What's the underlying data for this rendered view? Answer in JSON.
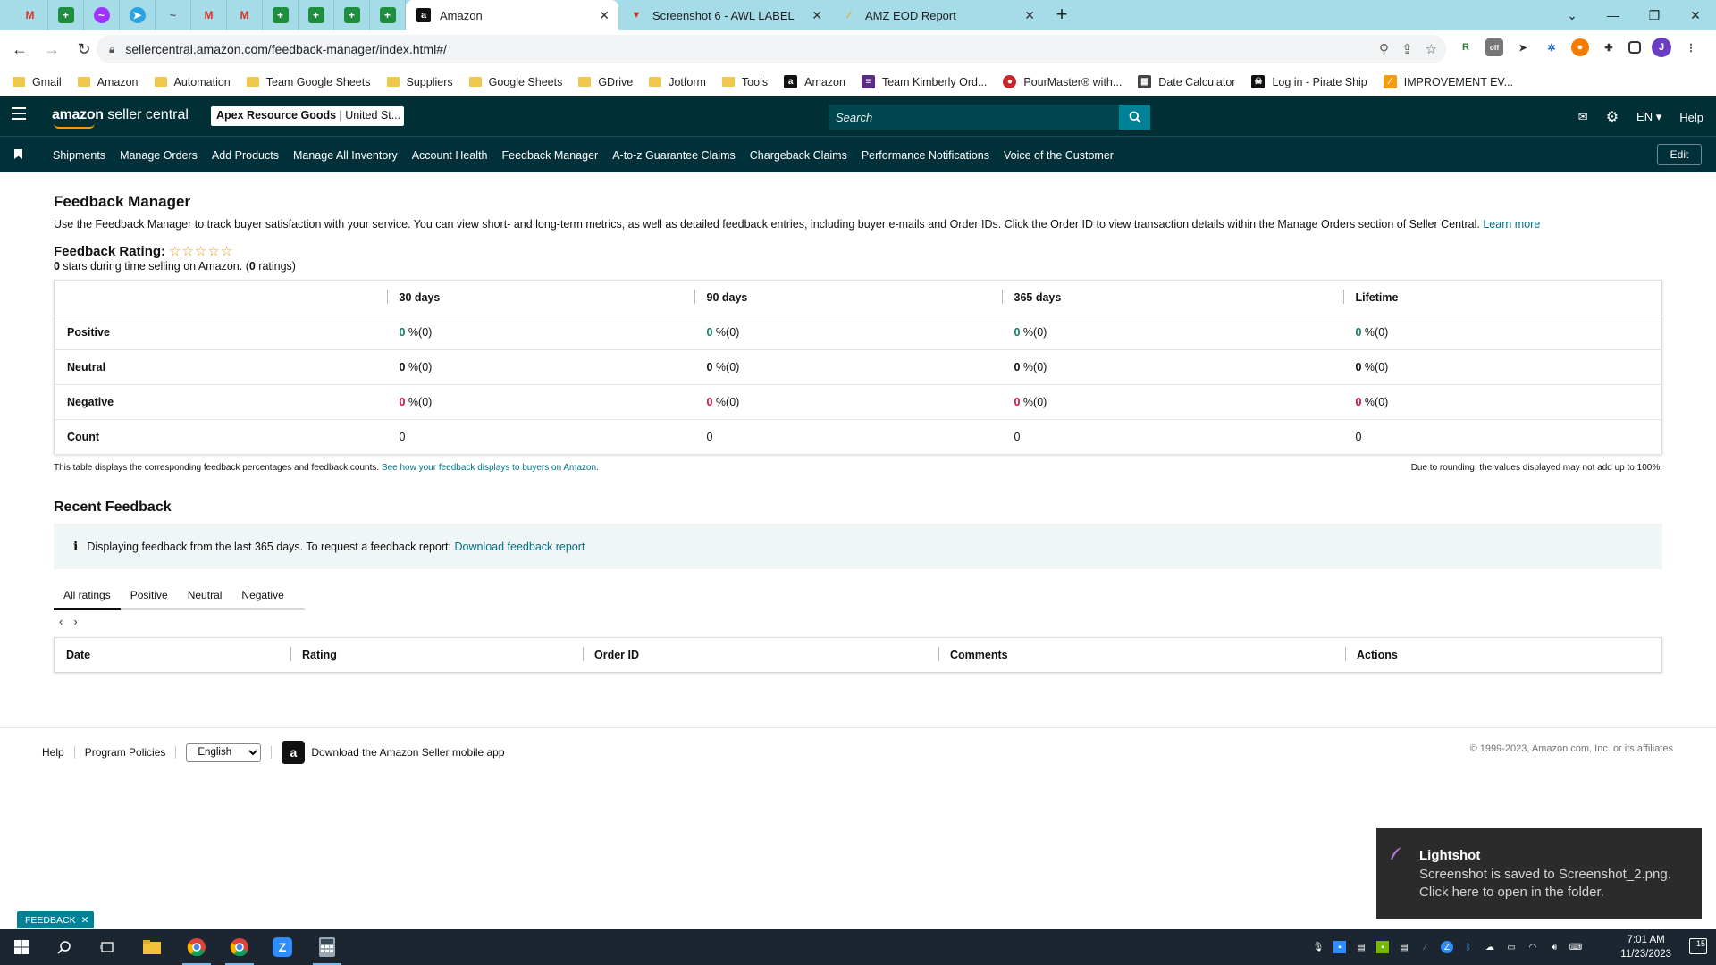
{
  "browser": {
    "tabs": [
      {
        "title": "Amazon",
        "active": true
      },
      {
        "title": "Screenshot 6 - AWL LABEL",
        "active": false
      },
      {
        "title": "AMZ EOD Report",
        "active": false
      }
    ],
    "new_tab": "+",
    "url": "sellercentral.amazon.com/feedback-manager/index.html#/",
    "bookmarks": [
      {
        "label": "Gmail",
        "type": "folder"
      },
      {
        "label": "Amazon",
        "type": "folder"
      },
      {
        "label": "Automation",
        "type": "folder"
      },
      {
        "label": "Team Google Sheets",
        "type": "folder"
      },
      {
        "label": "Suppliers",
        "type": "folder"
      },
      {
        "label": "Google Sheets",
        "type": "folder"
      },
      {
        "label": "GDrive",
        "type": "folder"
      },
      {
        "label": "Jotform",
        "type": "folder"
      },
      {
        "label": "Tools",
        "type": "folder"
      },
      {
        "label": "Amazon",
        "type": "site"
      },
      {
        "label": "Team Kimberly Ord...",
        "type": "site"
      },
      {
        "label": "PourMaster® with...",
        "type": "site"
      },
      {
        "label": "Date Calculator",
        "type": "site"
      },
      {
        "label": "Log in - Pirate Ship",
        "type": "site"
      },
      {
        "label": "IMPROVEMENT EV...",
        "type": "site"
      }
    ],
    "avatar_letter": "J"
  },
  "header": {
    "logo_bold": "amazon",
    "logo_rest": " seller central",
    "account_name": "Apex Resource Goods",
    "account_region": " | United St...",
    "search_placeholder": "Search",
    "language": "EN",
    "help": "Help"
  },
  "nav": {
    "items": [
      "Shipments",
      "Manage Orders",
      "Add Products",
      "Manage All Inventory",
      "Account Health",
      "Feedback Manager",
      "A-to-z Guarantee Claims",
      "Chargeback Claims",
      "Performance Notifications",
      "Voice of the Customer"
    ],
    "edit": "Edit"
  },
  "main": {
    "title": "Feedback Manager",
    "intro": "Use the Feedback Manager to track buyer satisfaction with your service. You can view short- and long-term metrics, as well as detailed feedback entries, including buyer e-mails and Order IDs. Click the Order ID to view transaction details within the Manage Orders section of Seller Central.",
    "learn_more": "Learn more",
    "rating_label": "Feedback Rating:",
    "stars_shown": "☆☆☆☆☆",
    "rating_count_bold": "0",
    "rating_sub_mid": " stars during time selling on Amazon. (",
    "rating_total_bold": "0",
    "rating_sub_end": " ratings)",
    "table": {
      "columns": [
        "30 days",
        "90 days",
        "365 days",
        "Lifetime"
      ],
      "rows": [
        {
          "label": "Positive",
          "tone": "green",
          "cells": [
            [
              "0",
              " %(0)"
            ],
            [
              "0",
              " %(0)"
            ],
            [
              "0",
              " %(0)"
            ],
            [
              "0",
              " %(0)"
            ]
          ]
        },
        {
          "label": "Neutral",
          "tone": "plain",
          "cells": [
            [
              "0",
              " %(0)"
            ],
            [
              "0",
              " %(0)"
            ],
            [
              "0",
              " %(0)"
            ],
            [
              "0",
              " %(0)"
            ]
          ]
        },
        {
          "label": "Negative",
          "tone": "red",
          "cells": [
            [
              "0",
              " %(0)"
            ],
            [
              "0",
              " %(0)"
            ],
            [
              "0",
              " %(0)"
            ],
            [
              "0",
              " %(0)"
            ]
          ]
        }
      ],
      "count_label": "Count",
      "counts": [
        "0",
        "0",
        "0",
        "0"
      ]
    },
    "note_left": "This table displays the corresponding feedback percentages and feedback counts.",
    "note_link": "See how your feedback displays to buyers on Amazon.",
    "note_right": "Due to rounding, the values displayed may not add up to 100%.",
    "recent_title": "Recent Feedback",
    "info_text": "Displaying feedback from the last 365 days. To request a feedback report:",
    "info_link": "Download feedback report",
    "filter_tabs": [
      "All ratings",
      "Positive",
      "Neutral",
      "Negative"
    ],
    "recent_columns": [
      "Date",
      "Rating",
      "Order ID",
      "Comments",
      "Actions"
    ]
  },
  "footer": {
    "help": "Help",
    "policies": "Program Policies",
    "language_selected": "English",
    "app_text": "Download the Amazon Seller mobile app",
    "copyright": "© 1999-2023, Amazon.com, Inc. or its affiliates"
  },
  "feedback_tab": "FEEDBACK",
  "toast": {
    "title": "Lightshot",
    "line1": "Screenshot is saved to Screenshot_2.png.",
    "line2": "Click here to open in the folder."
  },
  "taskbar": {
    "time": "7:01 AM",
    "date": "11/23/2023",
    "notification_count": "15"
  },
  "colors": {
    "header_bg": "#002f36",
    "accent_teal": "#008296",
    "positive": "#067d62",
    "negative": "#cc0c39",
    "tabbar_bg": "#a6dce8"
  }
}
